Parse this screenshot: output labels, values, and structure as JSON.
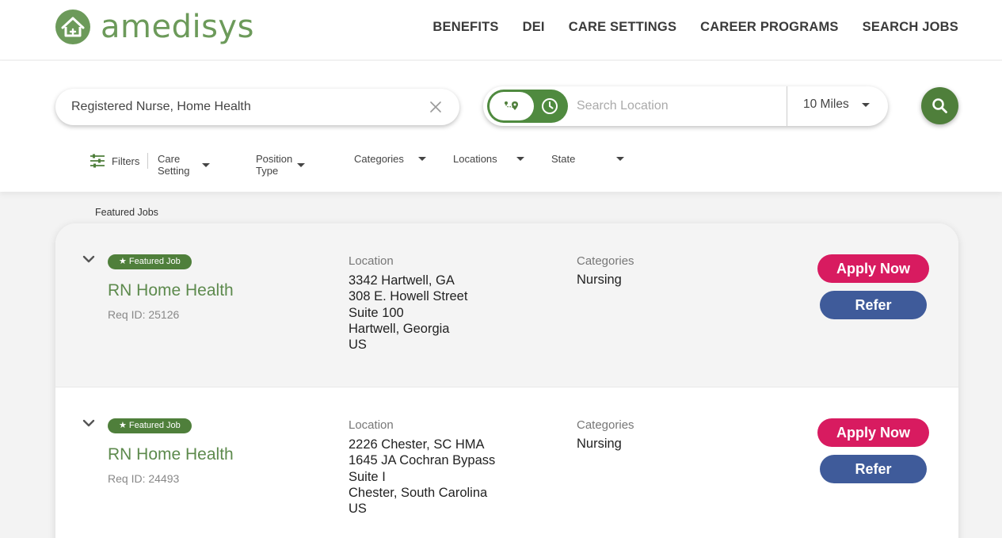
{
  "brand": {
    "name": "amedisys",
    "color": "#6c9a5a"
  },
  "nav": [
    "BENEFITS",
    "DEI",
    "CARE SETTINGS",
    "CAREER PROGRAMS",
    "SEARCH JOBS"
  ],
  "search": {
    "keyword_value": "Registered Nurse, Home Health",
    "location_placeholder": "Search Location",
    "radius": "10 Miles",
    "filters_label": "Filters",
    "filters": [
      "Care Setting",
      "Position Type",
      "Categories",
      "Locations",
      "State"
    ]
  },
  "results": {
    "heading": "Featured Jobs",
    "location_label": "Location",
    "categories_label": "Categories",
    "apply_label": "Apply Now",
    "refer_label": "Refer",
    "jobs": [
      {
        "badge": "★ Featured Job",
        "title": "RN Home Health",
        "req_id": "Req ID: 25126",
        "location_lines": [
          "3342 Hartwell, GA",
          "308 E. Howell Street",
          "Suite 100",
          "Hartwell, Georgia",
          "US"
        ],
        "category": "Nursing"
      },
      {
        "badge": "★ Featured Job",
        "title": "RN Home Health",
        "req_id": "Req ID: 24493",
        "location_lines": [
          "2226 Chester, SC HMA",
          "1645 JA Cochran Bypass",
          "Suite I",
          "Chester, South Carolina",
          "US"
        ],
        "category": "Nursing"
      }
    ]
  },
  "colors": {
    "primary_green": "#4f7f3b",
    "apply": "#d81b60",
    "refer": "#3f5b9a"
  }
}
